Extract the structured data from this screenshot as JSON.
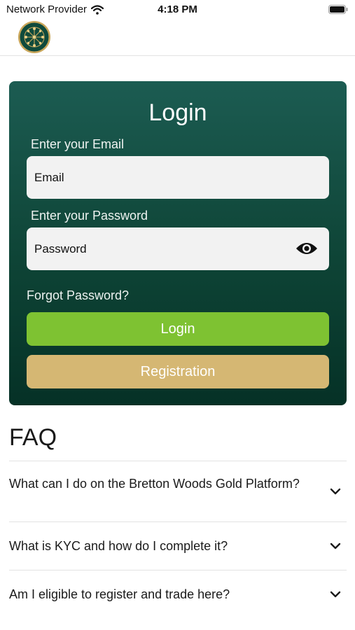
{
  "status_bar": {
    "carrier": "Network Provider",
    "time": "4:18 PM"
  },
  "header": {
    "logo_icon": "globe-network-logo-icon"
  },
  "login": {
    "title": "Login",
    "email_label": "Enter your Email",
    "email_placeholder": "Email",
    "password_label": "Enter your Password",
    "password_placeholder": "Password",
    "forgot_label": "Forgot Password?",
    "login_button": "Login",
    "register_button": "Registration"
  },
  "faq": {
    "title": "FAQ",
    "items": [
      {
        "question": "What can I do on the Bretton Woods Gold Platform?"
      },
      {
        "question": "What is KYC and how do I complete it?"
      },
      {
        "question": "Am I eligible to register and trade here?"
      }
    ]
  },
  "colors": {
    "card_top": "#1c5c52",
    "card_bottom": "#053126",
    "login_button": "#7ec232",
    "register_button": "#d5b773",
    "field_bg": "#f2f2f2"
  }
}
